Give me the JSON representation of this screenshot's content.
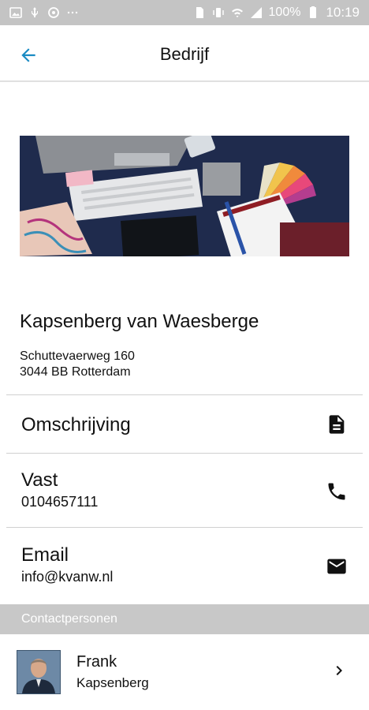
{
  "status_bar": {
    "battery": "100%",
    "time": "10:19",
    "icons": [
      "image-icon",
      "usb-icon",
      "sync-icon",
      "more-icon",
      "sim-icon",
      "vibrate-icon",
      "wifi-calling-icon",
      "signal-icon",
      "battery-icon"
    ]
  },
  "appbar": {
    "title": "Bedrijf",
    "back_icon": "arrow-back-icon",
    "accent": "#1a8bc3"
  },
  "company": {
    "name": "Kapsenberg van Waesberge",
    "address_line1": "Schuttevaerweg 160",
    "address_line2": "3044 BB  Rotterdam"
  },
  "rows": {
    "description": {
      "title": "Omschrijving",
      "icon": "document-icon"
    },
    "phone": {
      "title": "Vast",
      "value": "0104657111",
      "icon": "phone-icon"
    },
    "email": {
      "title": "Email",
      "value": "info@kvanw.nl",
      "icon": "mail-icon"
    }
  },
  "section": {
    "label": "Contactpersonen"
  },
  "contacts": [
    {
      "first_name": "Frank",
      "last_name": "Kapsenberg",
      "icon": "chevron-right-icon"
    }
  ]
}
